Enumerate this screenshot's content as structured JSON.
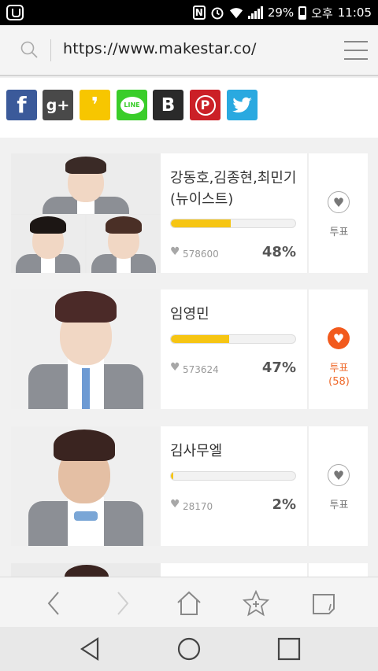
{
  "status_bar": {
    "battery": "29%",
    "ampm": "오후",
    "time": "11:05",
    "nfc": "N"
  },
  "browser": {
    "url": "https://www.makestar.co/"
  },
  "share": {
    "buttons": [
      {
        "name": "facebook",
        "label": "f",
        "color": "#3b5a9a"
      },
      {
        "name": "google-plus",
        "label": "g+",
        "color": "#494949"
      },
      {
        "name": "kakaostory",
        "label": "❜",
        "color": "#f7c600"
      },
      {
        "name": "line",
        "label": "LINE",
        "color": "#3acd2a"
      },
      {
        "name": "band",
        "label": "B",
        "color": "#2a2a2a"
      },
      {
        "name": "pinterest",
        "label": "P",
        "color": "#cb2027"
      },
      {
        "name": "twitter",
        "label": "🐦",
        "color": "#2aa9e0"
      }
    ]
  },
  "candidates": [
    {
      "name_line1": "강동호,김종현,최민기",
      "name_line2": "(뉴이스트)",
      "votes": "578600",
      "percent": "48%",
      "progress": 0.48,
      "vote_label": "투표",
      "vote_count": "",
      "voted": false
    },
    {
      "name_line1": "임영민",
      "name_line2": "",
      "votes": "573624",
      "percent": "47%",
      "progress": 0.47,
      "vote_label": "투표",
      "vote_count": "(58)",
      "voted": true
    },
    {
      "name_line1": "김사무엘",
      "name_line2": "",
      "votes": "28170",
      "percent": "2%",
      "progress": 0.02,
      "vote_label": "투표",
      "vote_count": "",
      "voted": false
    }
  ],
  "colors": {
    "bar_fill": "#f6c513",
    "vote_active": "#f25a1d"
  }
}
